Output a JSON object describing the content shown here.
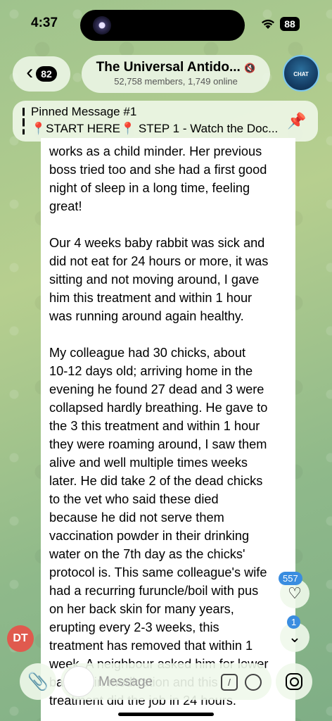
{
  "status": {
    "time": "4:37",
    "battery": "88"
  },
  "header": {
    "back_count": "82",
    "title": "The Universal Antido...",
    "subtitle": "52,758 members, 1,749 online",
    "avatar_text": "CHAT"
  },
  "pinned": {
    "title": "Pinned Message #1",
    "text": "📍START HERE📍 STEP 1 - Watch the Doc..."
  },
  "message": {
    "text": "works as a child minder. Her previous\nboss tried too and she had a first good\nnight of sleep in a long time, feeling\ngreat!\n\nOur 4 weeks baby rabbit was sick and\ndid not eat for 24 hours or more, it was\nsitting and not moving around, I gave\nhim this treatment and within 1 hour\nwas running around again healthy.\n\nMy colleague had 30 chicks, about\n10-12 days old; arriving home in the\nevening he found 27 dead and 3 were\ncollapsed hardly breathing. He gave to\nthe 3 this treatment and within 1 hour\nthey were roaming around, I saw them\nalive and well multiple times weeks\nlater. He did take 2 of the dead chicks\nto the vet who said these died\nbecause he did not serve them\nvaccination powder in their drinking\nwater on the 7th day as the chicks'\nprotocol is. This same colleague's wife\nhad a recurring furuncle/boil with pus\non her back skin for many years,\nerupting every 2-3 weeks, this\ntreatment has removed that within 1\nweek. A neighbour asked him for lower\nback pain medication and this\ntreatment did the job in 24 hours."
  },
  "reactions": {
    "count": "557",
    "unread": "1"
  },
  "sender_initials": "DT",
  "composer": {
    "placeholder": "Message"
  }
}
